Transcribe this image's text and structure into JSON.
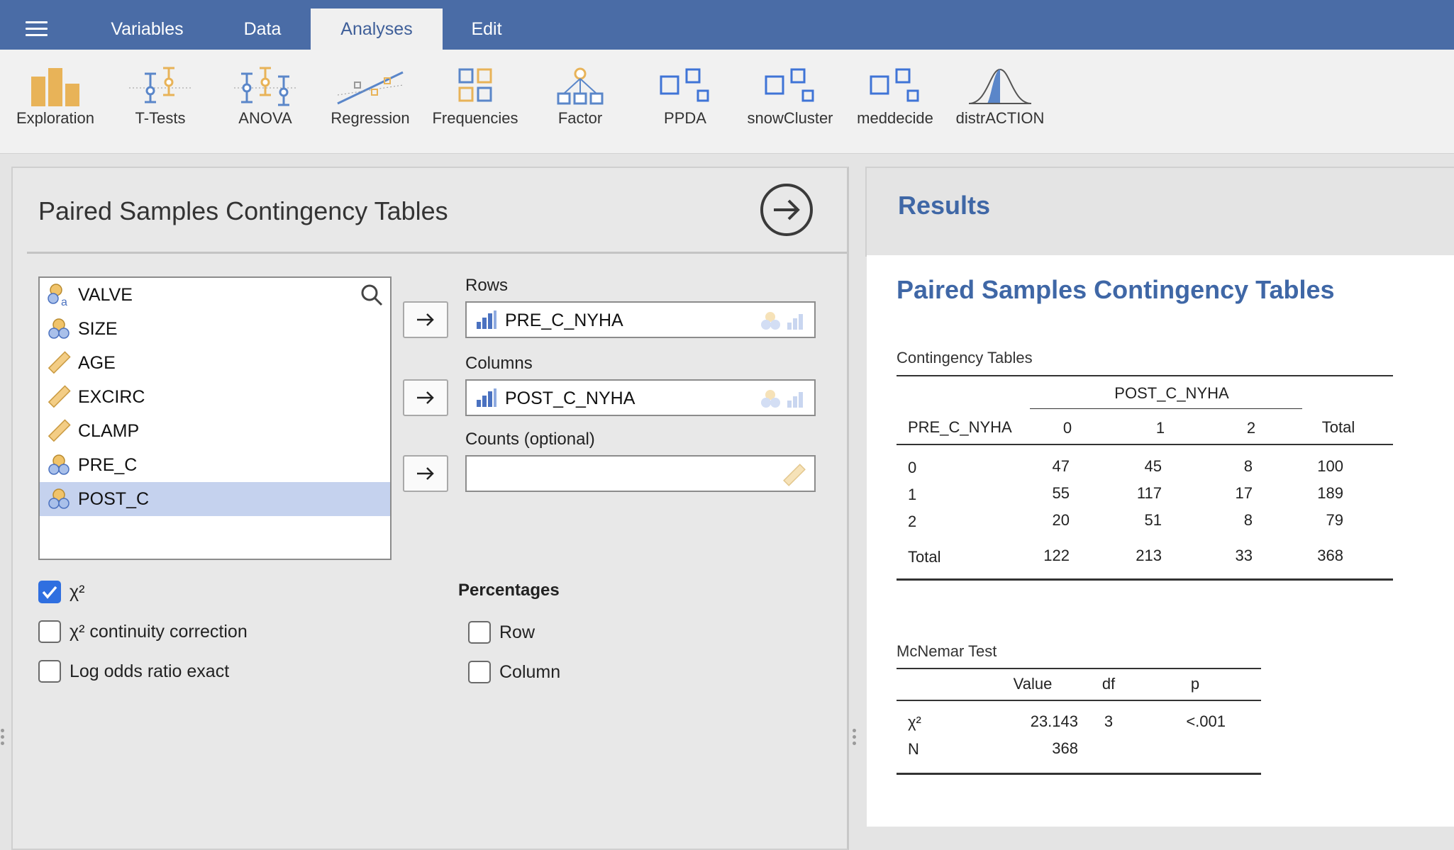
{
  "tabs": [
    {
      "label": "Variables",
      "active": false
    },
    {
      "label": "Data",
      "active": false
    },
    {
      "label": "Analyses",
      "active": true
    },
    {
      "label": "Edit",
      "active": false
    }
  ],
  "ribbon": [
    {
      "label": "Exploration",
      "icon": "exploration-icon"
    },
    {
      "label": "T-Tests",
      "icon": "ttests-icon"
    },
    {
      "label": "ANOVA",
      "icon": "anova-icon"
    },
    {
      "label": "Regression",
      "icon": "regression-icon"
    },
    {
      "label": "Frequencies",
      "icon": "frequencies-icon"
    },
    {
      "label": "Factor",
      "icon": "factor-icon"
    },
    {
      "label": "PPDA",
      "icon": "module-icon"
    },
    {
      "label": "snowCluster",
      "icon": "module-icon"
    },
    {
      "label": "meddecide",
      "icon": "module-icon"
    },
    {
      "label": "distrACTION",
      "icon": "distribution-icon"
    }
  ],
  "colors": {
    "topbar": "#4a6ca6",
    "accent": "#3f67a6",
    "selected_row": "#c5d2ee",
    "checkbox": "#2f6fe0"
  },
  "analysis": {
    "title": "Paired Samples Contingency Tables",
    "variables": [
      {
        "name": "VALVE",
        "type": "nominal-text",
        "selected": false
      },
      {
        "name": "SIZE",
        "type": "nominal",
        "selected": false
      },
      {
        "name": "AGE",
        "type": "continuous",
        "selected": false
      },
      {
        "name": "EXCIRC",
        "type": "continuous",
        "selected": false
      },
      {
        "name": "CLAMP",
        "type": "continuous",
        "selected": false
      },
      {
        "name": "PRE_C",
        "type": "nominal",
        "selected": false
      },
      {
        "name": "POST_C",
        "type": "nominal",
        "selected": true
      }
    ],
    "rows_label": "Rows",
    "rows_value": "PRE_C_NYHA",
    "columns_label": "Columns",
    "columns_value": "POST_C_NYHA",
    "counts_label": "Counts (optional)",
    "counts_value": "",
    "options": {
      "chi2": {
        "label": "χ²",
        "checked": true
      },
      "chi2_corr": {
        "label": "χ² continuity correction",
        "checked": false
      },
      "log_odds": {
        "label": "Log odds ratio exact",
        "checked": false
      }
    },
    "percentages": {
      "title": "Percentages",
      "row": {
        "label": "Row",
        "checked": false
      },
      "column": {
        "label": "Column",
        "checked": false
      }
    }
  },
  "results": {
    "title": "Results",
    "heading": "Paired Samples Contingency Tables",
    "contingency": {
      "caption": "Contingency Tables",
      "col_var": "POST_C_NYHA",
      "row_var": "PRE_C_NYHA",
      "col_headers": [
        "0",
        "1",
        "2",
        "Total"
      ],
      "rows": [
        {
          "label": "0",
          "values": [
            "47",
            "45",
            "8",
            "100"
          ]
        },
        {
          "label": "1",
          "values": [
            "55",
            "117",
            "17",
            "189"
          ]
        },
        {
          "label": "2",
          "values": [
            "20",
            "51",
            "8",
            "79"
          ]
        }
      ],
      "total": {
        "label": "Total",
        "values": [
          "122",
          "213",
          "33",
          "368"
        ]
      }
    },
    "mcnemar": {
      "caption": "McNemar Test",
      "headers": [
        "Value",
        "df",
        "p"
      ],
      "chi2_label": "χ²",
      "chi2_value": "23.143",
      "chi2_df": "3",
      "chi2_p": "<.001",
      "n_label": "N",
      "n_value": "368"
    }
  }
}
